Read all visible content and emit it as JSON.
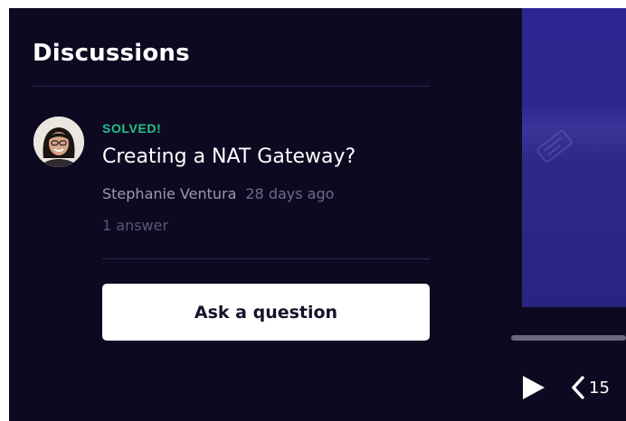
{
  "discussions": {
    "title": "Discussions",
    "item": {
      "status": "SOLVED!",
      "question": "Creating a NAT Gateway?",
      "author": "Stephanie Ventura",
      "age": "28 days ago",
      "answers": "1 answer",
      "avatar_icon": "user-avatar-photo"
    },
    "ask_button_label": "Ask a question"
  },
  "player": {
    "progress": 0,
    "rewind_label": "15",
    "play_icon": "play-icon",
    "rewind_icon": "rewind-icon"
  },
  "colors": {
    "background": "#0d0921",
    "solved": "#1fc28a",
    "video_panel": "#2c2690",
    "button_bg": "#ffffff"
  }
}
